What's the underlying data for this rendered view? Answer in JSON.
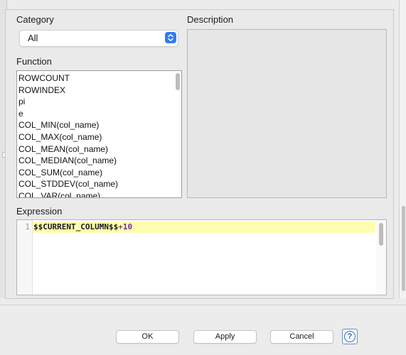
{
  "category": {
    "label": "Category",
    "selected": "All"
  },
  "description": {
    "label": "Description"
  },
  "function": {
    "label": "Function",
    "items": [
      "ROWCOUNT",
      "ROWINDEX",
      "pi",
      "e",
      "COL_MIN(col_name)",
      "COL_MAX(col_name)",
      "COL_MEAN(col_name)",
      "COL_MEDIAN(col_name)",
      "COL_SUM(col_name)",
      "COL_STDDEV(col_name)",
      "COL_VAR(col_name)"
    ]
  },
  "expression": {
    "label": "Expression",
    "line_number": "1",
    "column_token": "$$CURRENT_COLUMN$$",
    "operator": "+",
    "number": "10"
  },
  "buttons": {
    "ok": "OK",
    "apply": "Apply",
    "cancel": "Cancel",
    "help": "?"
  }
}
